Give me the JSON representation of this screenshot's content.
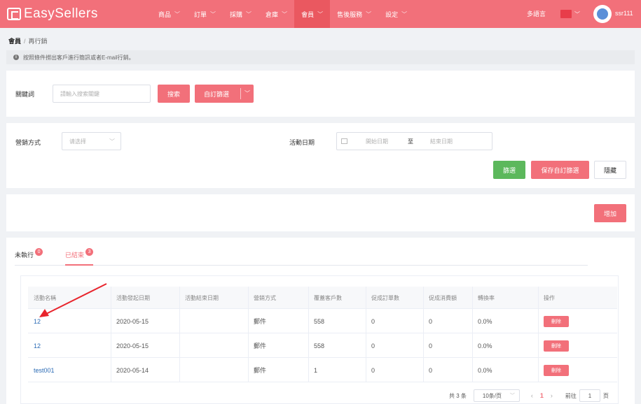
{
  "header": {
    "brand": "EasySellers",
    "nav": [
      {
        "label": "商品",
        "active": false
      },
      {
        "label": "訂單",
        "active": false
      },
      {
        "label": "採購",
        "active": false
      },
      {
        "label": "倉庫",
        "active": false
      },
      {
        "label": "會員",
        "active": true
      },
      {
        "label": "售後服務",
        "active": false
      },
      {
        "label": "設定",
        "active": false
      }
    ],
    "language": "多語言",
    "username": "ssr111",
    "colors": {
      "bar": "#f2707a",
      "active_nav": "#ea5860",
      "swatch": "#e83d4a"
    }
  },
  "breadcrumb": {
    "root": "會員",
    "separator": "/",
    "current": "再行銷"
  },
  "notice": "按照條件撈出客戶進行簡訊或者E-mail行銷。",
  "search": {
    "keyword_label": "關鍵詞",
    "keyword_placeholder": "請輸入搜索關鍵",
    "search_btn": "搜索",
    "custom_filter_btn": "自訂篩選"
  },
  "filters": {
    "method_label": "營銷方式",
    "method_placeholder": "请选择",
    "date_label": "活動日期",
    "start_placeholder": "開始日期",
    "date_sep": "至",
    "end_placeholder": "結束日期",
    "filter_btn": "篩選",
    "save_filter_btn": "保存自訂篩選",
    "hide_btn": "隱藏"
  },
  "add_btn": "增加",
  "tabs": [
    {
      "label": "未執行",
      "count": "0",
      "active": false
    },
    {
      "label": "已結束",
      "count": "3",
      "active": true
    }
  ],
  "table": {
    "headers": [
      "活動名稱",
      "活動發起日期",
      "活動結束日期",
      "營銷方式",
      "覆蓋客戶數",
      "促成訂單數",
      "促成消費額",
      "轉換率",
      "操作"
    ],
    "rows": [
      {
        "name": "12",
        "start": "2020-05-15",
        "end": "",
        "method": "郵件",
        "customers": "558",
        "orders": "0",
        "amount": "0",
        "rate": "0.0%",
        "action": "刪除"
      },
      {
        "name": "12",
        "start": "2020-05-15",
        "end": "",
        "method": "郵件",
        "customers": "558",
        "orders": "0",
        "amount": "0",
        "rate": "0.0%",
        "action": "刪除"
      },
      {
        "name": "test001",
        "start": "2020-05-14",
        "end": "",
        "method": "郵件",
        "customers": "1",
        "orders": "0",
        "amount": "0",
        "rate": "0.0%",
        "action": "刪除"
      }
    ]
  },
  "pagination": {
    "total": "共 3 条",
    "page_size": "10条/页",
    "current_page": "1",
    "goto_label": "前往",
    "goto_value": "1",
    "page_suffix": "页"
  }
}
